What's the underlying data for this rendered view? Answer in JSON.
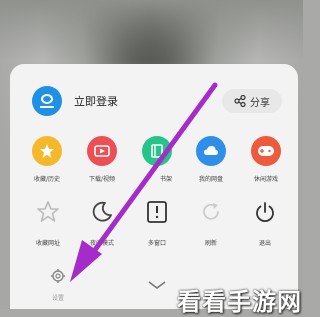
{
  "login": {
    "label": "立即登录"
  },
  "share": {
    "label": "分享"
  },
  "grid_row1": [
    {
      "label": "收藏/历史",
      "icon": "star-icon",
      "color": "#f5b82b"
    },
    {
      "label": "下载/视频",
      "icon": "download-video-icon",
      "color": "#ee4f55"
    },
    {
      "label": "书架",
      "icon": "bookshelf-icon",
      "color": "#25c48b"
    },
    {
      "label": "我的网盘",
      "icon": "cloud-drive-icon",
      "color": "#2f8fe8"
    },
    {
      "label": "休闲游戏",
      "icon": "game-controller-icon",
      "color": "#ee5a3d"
    }
  ],
  "grid_row2": [
    {
      "label": "收藏网址",
      "icon": "bookmark-star-icon"
    },
    {
      "label": "夜间模式",
      "icon": "moon-icon"
    },
    {
      "label": "多窗口",
      "icon": "window-icon"
    },
    {
      "label": "刷新",
      "icon": "refresh-icon"
    },
    {
      "label": "退出",
      "icon": "power-icon"
    }
  ],
  "bottom": {
    "settings_label": "设置"
  },
  "watermark": "看看手游网",
  "colors": {
    "arrow": "#a52cc8",
    "accent": "#1e90e6"
  }
}
